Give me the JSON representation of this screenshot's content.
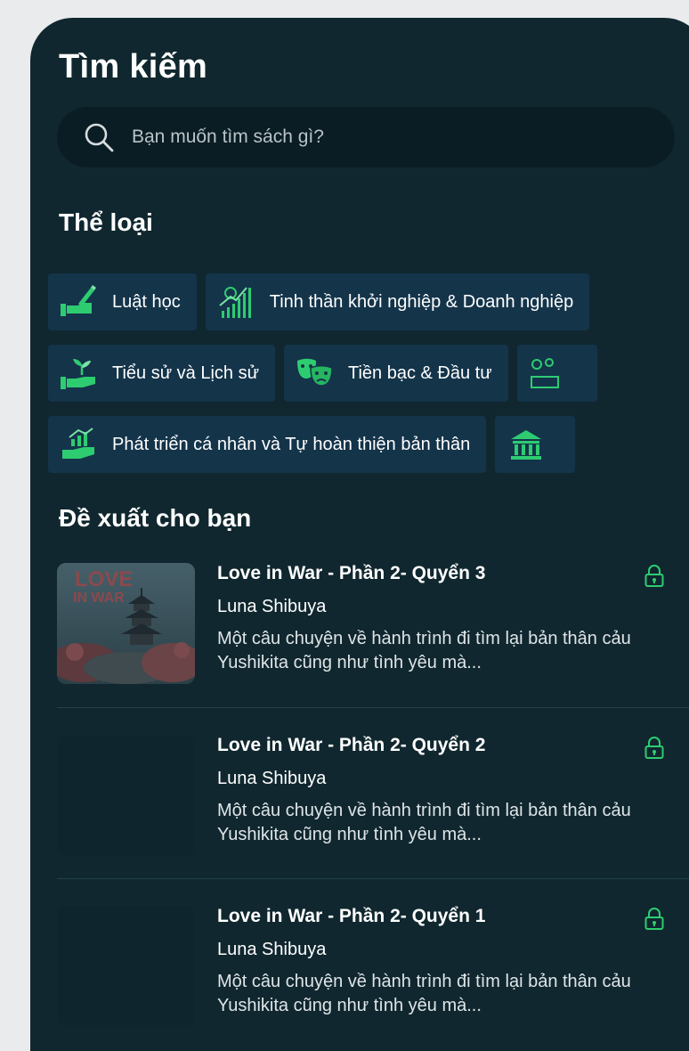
{
  "header": {
    "title": "Tìm kiếm"
  },
  "search": {
    "placeholder": "Bạn muốn tìm sách gì?"
  },
  "categories_section": {
    "title": "Thể loại"
  },
  "categories": {
    "row1": [
      {
        "label": "Luật học",
        "icon": "law-hand-pen-icon"
      },
      {
        "label": "Tinh thần khởi nghiệp & Doanh nghiệp",
        "icon": "growth-chart-icon"
      }
    ],
    "row2": [
      {
        "label": "Tiểu sử và Lịch sử",
        "icon": "plant-hand-icon"
      },
      {
        "label": "Tiền bạc & Đầu tư",
        "icon": "theater-masks-icon"
      },
      {
        "label": "",
        "icon": "people-icon"
      }
    ],
    "row3": [
      {
        "label": "Phát triển cá nhân và Tự hoàn thiện bản thân",
        "icon": "personal-growth-icon"
      },
      {
        "label": "",
        "icon": "government-building-icon"
      }
    ]
  },
  "recommend_section": {
    "title": "Đề xuất cho bạn"
  },
  "books": [
    {
      "title": "Love in War - Phần 2- Quyển 3",
      "author": "Luna Shibuya",
      "description": "Một câu chuyện về hành trình đi tìm lại bản thân cảu Yushikita cũng như tình yêu mà...",
      "cover_text": "LOVE",
      "cover_subtext": "IN WAR",
      "locked": true
    },
    {
      "title": "Love in War - Phần 2- Quyển 2",
      "author": "Luna Shibuya",
      "description": "Một câu chuyện về hành trình đi tìm lại bản thân cảu Yushikita cũng như tình yêu mà...",
      "locked": true
    },
    {
      "title": "Love in War - Phần 2- Quyển 1",
      "author": "Luna Shibuya",
      "description": "Một câu chuyện về hành trình đi tìm lại bản thân cảu Yushikita cũng như tình yêu mà...",
      "locked": true
    }
  ],
  "colors": {
    "background": "#10272f",
    "chip": "#14344a",
    "accent": "#2ecc71",
    "search_bg": "#0b1d24"
  }
}
